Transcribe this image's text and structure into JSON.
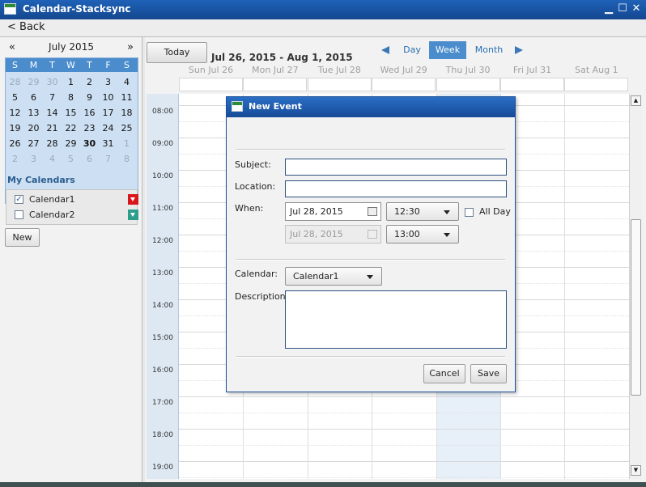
{
  "window": {
    "title": "Calendar-Stacksync",
    "minimize": "▁",
    "maximize": "☐",
    "close": "✕"
  },
  "backbar": {
    "back_label": "< Back"
  },
  "minical": {
    "prev": "«",
    "next": "»",
    "month_label": "July 2015",
    "dow": [
      "S",
      "M",
      "T",
      "W",
      "T",
      "F",
      "S"
    ],
    "weeks": [
      [
        {
          "d": "28",
          "out": true
        },
        {
          "d": "29",
          "out": true
        },
        {
          "d": "30",
          "out": true
        },
        {
          "d": "1"
        },
        {
          "d": "2"
        },
        {
          "d": "3"
        },
        {
          "d": "4"
        }
      ],
      [
        {
          "d": "5"
        },
        {
          "d": "6"
        },
        {
          "d": "7"
        },
        {
          "d": "8"
        },
        {
          "d": "9"
        },
        {
          "d": "10"
        },
        {
          "d": "11"
        }
      ],
      [
        {
          "d": "12"
        },
        {
          "d": "13"
        },
        {
          "d": "14"
        },
        {
          "d": "15"
        },
        {
          "d": "16"
        },
        {
          "d": "17"
        },
        {
          "d": "18"
        }
      ],
      [
        {
          "d": "19"
        },
        {
          "d": "20"
        },
        {
          "d": "21"
        },
        {
          "d": "22"
        },
        {
          "d": "23"
        },
        {
          "d": "24"
        },
        {
          "d": "25"
        }
      ],
      [
        {
          "d": "26"
        },
        {
          "d": "27"
        },
        {
          "d": "28"
        },
        {
          "d": "29"
        },
        {
          "d": "30",
          "today": true
        },
        {
          "d": "31"
        },
        {
          "d": "1",
          "out": true
        }
      ],
      [
        {
          "d": "2",
          "out": true
        },
        {
          "d": "3",
          "out": true
        },
        {
          "d": "4",
          "out": true
        },
        {
          "d": "5",
          "out": true
        },
        {
          "d": "6",
          "out": true
        },
        {
          "d": "7",
          "out": true
        },
        {
          "d": "8",
          "out": true
        }
      ]
    ]
  },
  "my_calendars": {
    "title": "My Calendars",
    "items": [
      {
        "name": "Calendar1",
        "checked": true,
        "color": "#d9161d"
      },
      {
        "name": "Calendar2",
        "checked": false,
        "color": "#2e9e8c"
      }
    ],
    "new_label": "New"
  },
  "toolbar": {
    "today_label": "Today",
    "date_range": "Jul 26, 2015 - Aug 1, 2015",
    "views": [
      "Day",
      "Week",
      "Month"
    ],
    "active_view": "Week"
  },
  "week": {
    "days": [
      "Sun Jul 26",
      "Mon Jul 27",
      "Tue Jul 28",
      "Wed Jul 29",
      "Thu Jul 30",
      "Fri Jul 31",
      "Sat Aug 1"
    ],
    "hours": [
      "08:00",
      "09:00",
      "10:00",
      "11:00",
      "12:00",
      "13:00",
      "14:00",
      "15:00",
      "16:00",
      "17:00",
      "18:00",
      "19:00"
    ]
  },
  "dialog": {
    "title": "New Event",
    "subject_label": "Subject:",
    "subject_value": "",
    "location_label": "Location:",
    "location_value": "",
    "when_label": "When:",
    "start_date": "Jul 28, 2015",
    "start_time": "12:30",
    "allday_label": "All Day",
    "allday_checked": false,
    "end_date": "Jul 28, 2015",
    "end_time": "13:00",
    "calendar_label": "Calendar:",
    "calendar_value": "Calendar1",
    "description_label": "Description:",
    "description_value": "",
    "cancel_label": "Cancel",
    "save_label": "Save"
  },
  "colors": {
    "titlebar": "#1a55a6",
    "accent": "#4a8ccc",
    "today_column": "#e7eff8",
    "time_column": "#dde8f3"
  }
}
